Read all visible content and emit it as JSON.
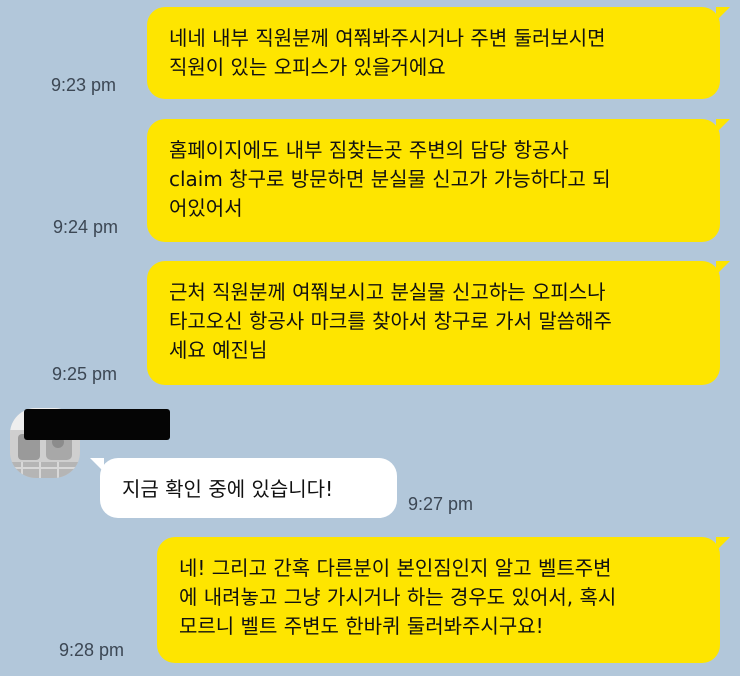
{
  "chat": {
    "messages": [
      {
        "side": "me",
        "text": "네네 내부 직원분께 여쭤봐주시거나 주변 둘러보시면\n직원이 있는 오피스가 있을거에요",
        "time": "9:23 pm"
      },
      {
        "side": "me",
        "text": "홈페이지에도 내부 짐찾는곳 주변의 담당 항공사\nclaim 창구로 방문하면 분실물 신고가 가능하다고 되\n어있어서",
        "time": "9:24 pm"
      },
      {
        "side": "me",
        "text": "근처 직원분께 여쭤보시고 분실물 신고하는 오피스나\n타고오신 항공사 마크를 찾아서 창구로 가서 말씀해주\n세요 예진님",
        "time": "9:25 pm"
      },
      {
        "side": "other",
        "text": "지금 확인 중에 있습니다!",
        "time": "9:27 pm"
      },
      {
        "side": "me",
        "text": "네! 그리고 간혹 다른분이 본인짐인지 알고 벨트주변\n에 내려놓고 그냥 가시거나 하는 경우도 있어서, 혹시\n모르니 벨트 주변도 한바퀴 둘러봐주시구요!",
        "time": "9:28 pm"
      }
    ]
  },
  "colors": {
    "background": "#b2c7da",
    "my_bubble": "#fee500",
    "their_bubble": "#ffffff"
  }
}
